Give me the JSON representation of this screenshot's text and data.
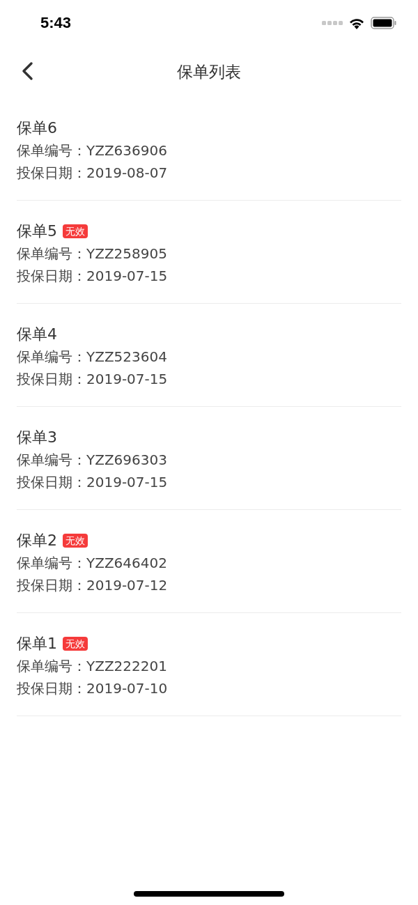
{
  "status_bar": {
    "time": "5:43"
  },
  "nav": {
    "title": "保单列表"
  },
  "policies": [
    {
      "name": "保单6",
      "number_label": "保单编号：",
      "number": "YZZ636906",
      "date_label": "投保日期：",
      "date": "2019-08-07"
    },
    {
      "name": "保单5",
      "badge": "无效",
      "number_label": "保单编号：",
      "number": "YZZ258905",
      "date_label": "投保日期：",
      "date": "2019-07-15"
    },
    {
      "name": "保单4",
      "number_label": "保单编号：",
      "number": "YZZ523604",
      "date_label": "投保日期：",
      "date": "2019-07-15"
    },
    {
      "name": "保单3",
      "number_label": "保单编号：",
      "number": "YZZ696303",
      "date_label": "投保日期：",
      "date": "2019-07-15"
    },
    {
      "name": "保单2",
      "badge": "无效",
      "number_label": "保单编号：",
      "number": "YZZ646402",
      "date_label": "投保日期：",
      "date": "2019-07-12"
    },
    {
      "name": "保单1",
      "badge": "无效",
      "number_label": "保单编号：",
      "number": "YZZ222201",
      "date_label": "投保日期：",
      "date": "2019-07-10"
    }
  ]
}
